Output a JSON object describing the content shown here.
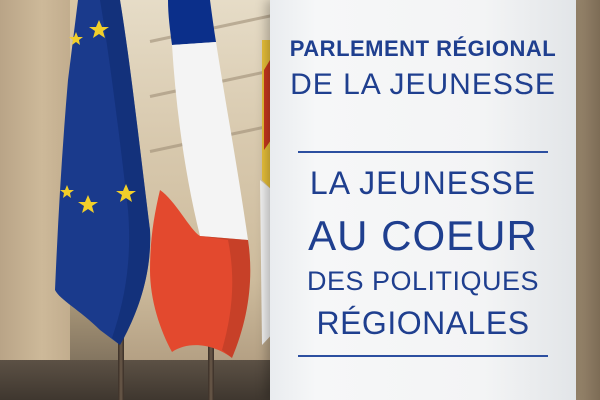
{
  "banner": {
    "header_line1": "PARLEMENT RÉGIONAL",
    "header_line2": "DE LA JEUNESSE",
    "slogan_line1": "LA JEUNESSE",
    "slogan_line2": "AU COEUR",
    "slogan_line3": "DES POLITIQUES",
    "slogan_line4": "RÉGIONALES",
    "text_color": "#1f3f8f"
  },
  "flags": {
    "eu": {
      "field_color": "#1a3a8c",
      "star_color": "#f2cf2a"
    },
    "france": {
      "colors": [
        "#0b2f8a",
        "#f4f4f4",
        "#e3492e"
      ]
    },
    "regional": {
      "colors": [
        "#e9c13a",
        "#c9381f",
        "#f1f1f1"
      ]
    }
  }
}
